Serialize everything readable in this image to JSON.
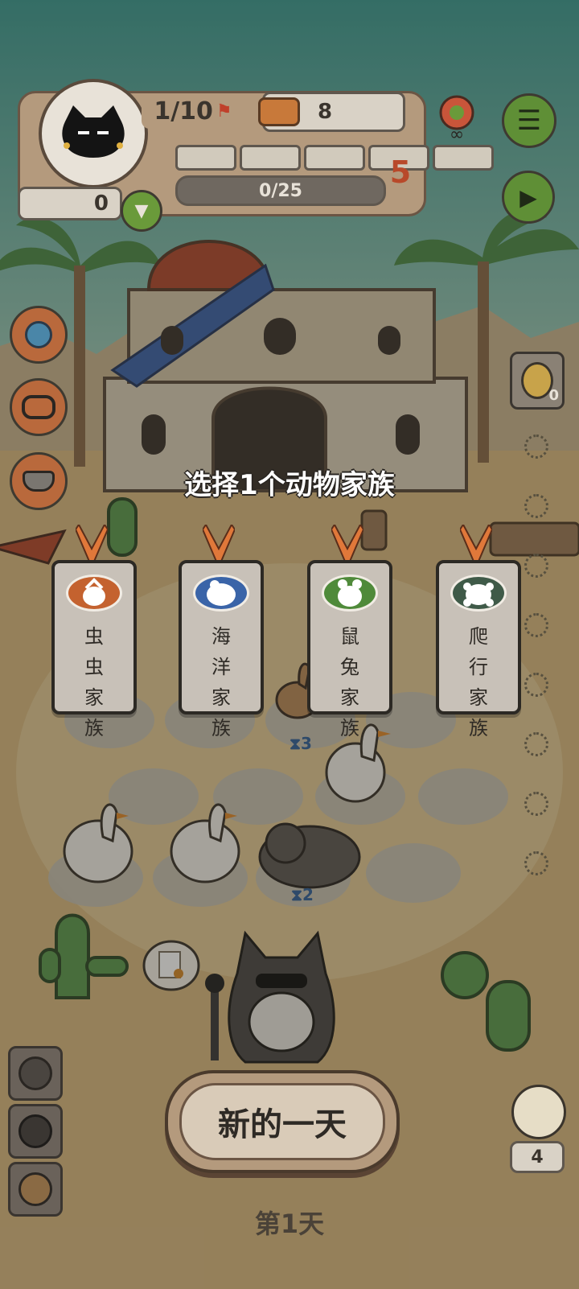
{
  "hud": {
    "pet_count": "1/10",
    "food_count": "8",
    "xp_progress": "0/25",
    "level": "5",
    "coins": "0",
    "segments_filled": 0,
    "segments_total": 5
  },
  "prompt": {
    "title": "选择1个动物家族"
  },
  "families": [
    {
      "label": "虫虫家族",
      "color": "#c4622f"
    },
    {
      "label": "海洋家族",
      "color": "#3a64a8"
    },
    {
      "label": "鼠兔家族",
      "color": "#4f8a3a"
    },
    {
      "label": "爬行家族",
      "color": "#3f5a48"
    }
  ],
  "board": {
    "timer_a": "3",
    "timer_b": "2"
  },
  "side": {
    "relic_count": "0",
    "bird_count": "4"
  },
  "actions": {
    "new_day": "新的一天",
    "day_label": "第1天"
  },
  "colors": {
    "panel": "#b49a7d",
    "green_button": "#6a9a3a",
    "sky": "#8fb7a6"
  }
}
